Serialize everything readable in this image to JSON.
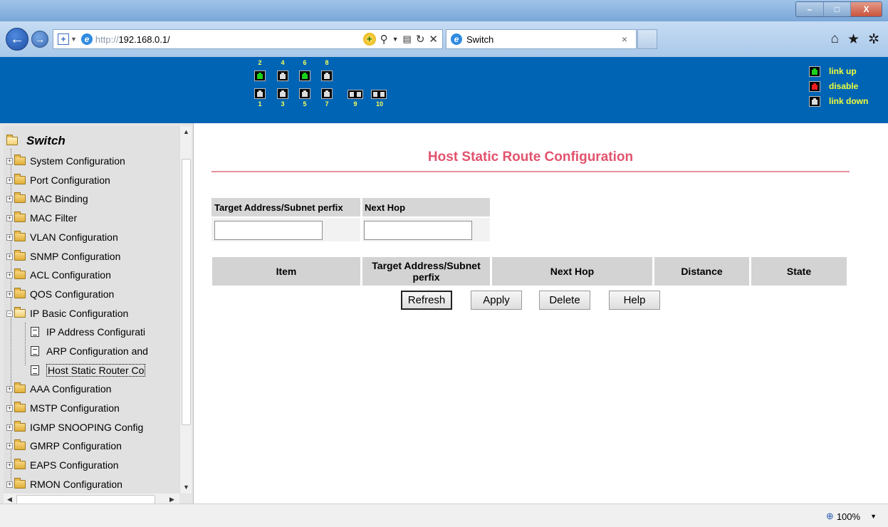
{
  "browser": {
    "address_scheme": "http://",
    "address_host": "192.168.0.1/",
    "tab_title": "Switch",
    "tab_close": "×",
    "zoom": "100%",
    "window_controls": [
      "–",
      "□",
      "X"
    ]
  },
  "ports": {
    "top_numbers": [
      "2",
      "4",
      "6",
      "8"
    ],
    "bottom_numbers": [
      "1",
      "3",
      "5",
      "7"
    ],
    "fiber_numbers": [
      "9",
      "10"
    ],
    "status": {
      "2": "up",
      "4": "down",
      "6": "up",
      "8": "down",
      "1": "down",
      "3": "down",
      "5": "down",
      "7": "down",
      "9": "down",
      "10": "down"
    }
  },
  "legend": {
    "link_up": "link up",
    "disable": "disable",
    "link_down": "link down"
  },
  "tree": {
    "root": "Switch",
    "items": [
      {
        "label": "System Configuration"
      },
      {
        "label": "Port Configuration"
      },
      {
        "label": "MAC Binding"
      },
      {
        "label": "MAC Filter"
      },
      {
        "label": "VLAN Configuration"
      },
      {
        "label": "SNMP Configuration"
      },
      {
        "label": "ACL Configuration"
      },
      {
        "label": "QOS Configuration"
      },
      {
        "label": "IP Basic Configuration"
      },
      {
        "label": "IP Address Configurati"
      },
      {
        "label": "ARP Configuration and"
      },
      {
        "label": "Host Static Router Co"
      },
      {
        "label": "AAA Configuration"
      },
      {
        "label": "MSTP Configuration"
      },
      {
        "label": "IGMP SNOOPING Config"
      },
      {
        "label": "GMRP Configuration"
      },
      {
        "label": "EAPS Configuration"
      },
      {
        "label": "RMON Configuration"
      }
    ]
  },
  "main": {
    "title": "Host Static Route Configuration",
    "form": {
      "target_label": "Target Address/Subnet perfix",
      "nexthop_label": "Next Hop",
      "target_value": "",
      "nexthop_value": ""
    },
    "table": {
      "columns": [
        "Item",
        "Target Address/Subnet perfix",
        "Next Hop",
        "Distance",
        "State"
      ],
      "rows": []
    },
    "buttons": {
      "refresh": "Refresh",
      "apply": "Apply",
      "delete": "Delete",
      "help": "Help"
    }
  },
  "colors": {
    "header_bg": "#0064b4",
    "title": "#e2536e",
    "link_up": "#1bd11b",
    "disable": "#f01d1d",
    "legend_text": "#f0ff3c"
  }
}
